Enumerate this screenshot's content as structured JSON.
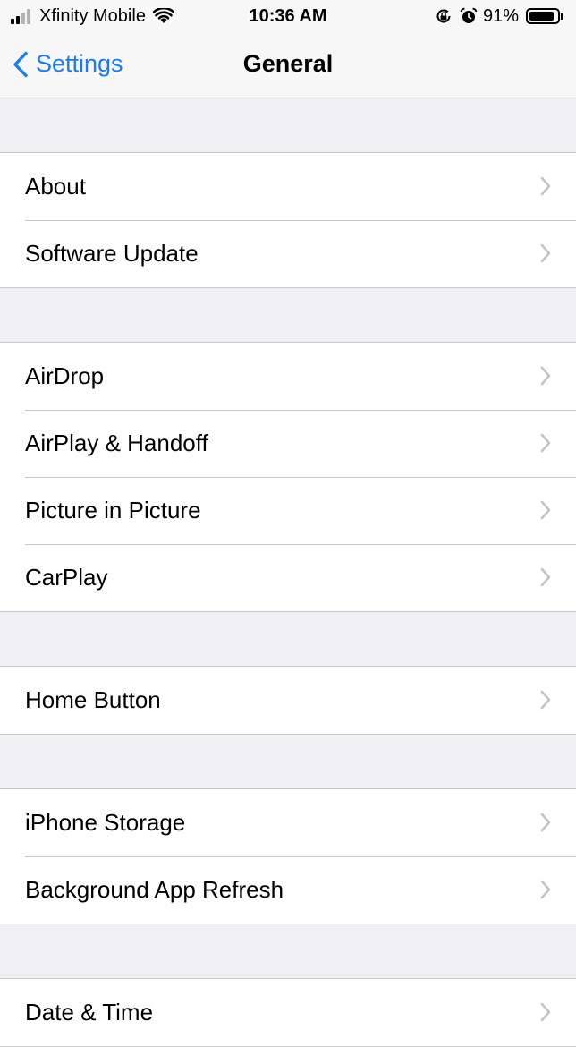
{
  "status_bar": {
    "carrier": "Xfinity Mobile",
    "time": "10:36 AM",
    "battery_percent": "91%",
    "battery_level": 0.91,
    "signal_bars_filled": 2,
    "icons": [
      "signal-icon",
      "wifi-icon",
      "orientation-lock-icon",
      "alarm-icon",
      "battery-icon"
    ]
  },
  "nav": {
    "back_label": "Settings",
    "title": "General"
  },
  "sections": [
    {
      "items": [
        "About",
        "Software Update"
      ]
    },
    {
      "items": [
        "AirDrop",
        "AirPlay & Handoff",
        "Picture in Picture",
        "CarPlay"
      ]
    },
    {
      "items": [
        "Home Button"
      ]
    },
    {
      "items": [
        "iPhone Storage",
        "Background App Refresh"
      ]
    },
    {
      "items": [
        "Date & Time"
      ]
    }
  ],
  "colors": {
    "accent": "#1a7cf5",
    "background": "#efeff4",
    "separator": "#c8c7cc",
    "chevron": "#c4c4c7"
  }
}
